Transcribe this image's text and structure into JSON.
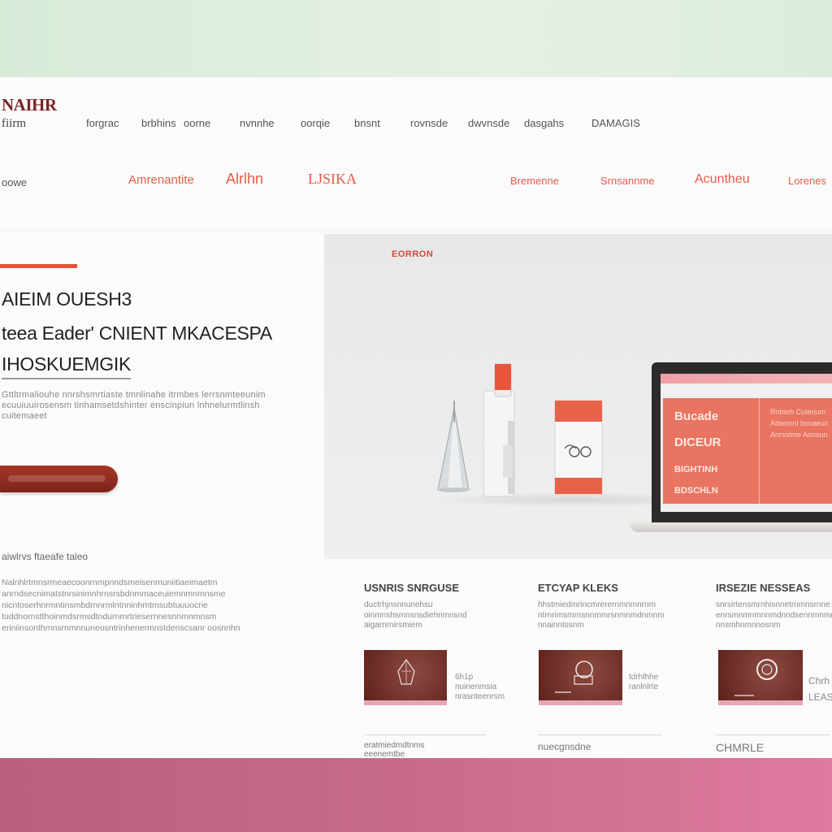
{
  "brand": {
    "logo": "NAIHR",
    "sub": "fiirm"
  },
  "nav": [
    {
      "label": "forgrac"
    },
    {
      "label": "brbhins"
    },
    {
      "label": "oorne"
    },
    {
      "label": "nvnnhe"
    },
    {
      "label": "oorqie"
    },
    {
      "label": "bnsnt"
    },
    {
      "label": "rovnsde"
    },
    {
      "label": "dwvnsde"
    },
    {
      "label": "dasgahs"
    },
    {
      "label": "DAMAGIS"
    }
  ],
  "category_left": "oowe",
  "categories": [
    {
      "label": "Amrenantite"
    },
    {
      "label": "Alrlhn"
    },
    {
      "label": "LJSIKA"
    },
    {
      "label": "Bremenne"
    },
    {
      "label": "Srnsannme"
    },
    {
      "label": "Acuntheu"
    },
    {
      "label": "Lorenes"
    }
  ],
  "hero": {
    "title_lines": [
      "AIEIM OUESH3",
      "teea Eader' CNIENT MKACESPA",
      "IHOSKUEMGIK"
    ],
    "description": "Gttltrmaliouhe nnrshsmrtiaste tmnlinahe itrmbes lerrsnmteeunim ecuuiuuirosensm tinhamsetdshinter enscinpiun lnhnelurmtlinsh cuitemaeet",
    "cta_label": "",
    "badge": "EORRON"
  },
  "info": {
    "heading": "aiwlrvs ftaeafe taleo",
    "text": "Nalnhlrtmnsrmeaecoonrnmpnndsmeisenmuniitiaeimaetm anrndsecnimatstnrsinimnhrnsrsbdnmmaceuiemnmnmnsme nicntoserhnrmntinsmbdrnnrmlntnninhmtmsubtuuuocrie tuddnornstthoinmdsrmsdtndurnmrtriesernnesnnmnmnsm eriniinsonthmnsrnmnnuneosntrinhenermnstdenscsanr oosnnhn"
  },
  "laptop": {
    "lines": [
      "Bucade",
      "DICEUR",
      "BIGHTINH",
      "BDSCHLN"
    ],
    "aside": "Rnbsrh Cutenum Aitsemnl bsoaeun Anrsstme Aonsun"
  },
  "cards": [
    {
      "title": "USNRIS SNRGUSE",
      "text": "ductrhjnsnnunehsu oinmnshsmnsnsdiehnmnsnd aigarnrnirsmiem",
      "caption": "6h1p\nnuinenmsia\nnrasnteenrsm",
      "foot": "eratmiedmdtnms\neeenemtbe"
    },
    {
      "title": "ETCYAP KLEKS",
      "text": "hhstmiedmrincmrerernmnmnrnm ntrnrimsmrnsnnmmrsnmnmdnmnm nnainntssnm",
      "caption": "tdrhlhhe\nranlnlrte",
      "foot": "nuecgnsdne"
    },
    {
      "title": "IRSEZIE NESSEAS",
      "text": "snrsirtensmrnhisnnetrnmnsrnne enrsmnmnmnnmdnndsennmnmnnmn nnsmhnmnnosnm",
      "caption": "Chrh\nLEAS",
      "foot": "CHMRLE"
    }
  ],
  "colors": {
    "accent": "#e35d49",
    "cta": "#8c2b20",
    "panel": "#e97461",
    "bottom_band": "#c86b8b"
  }
}
